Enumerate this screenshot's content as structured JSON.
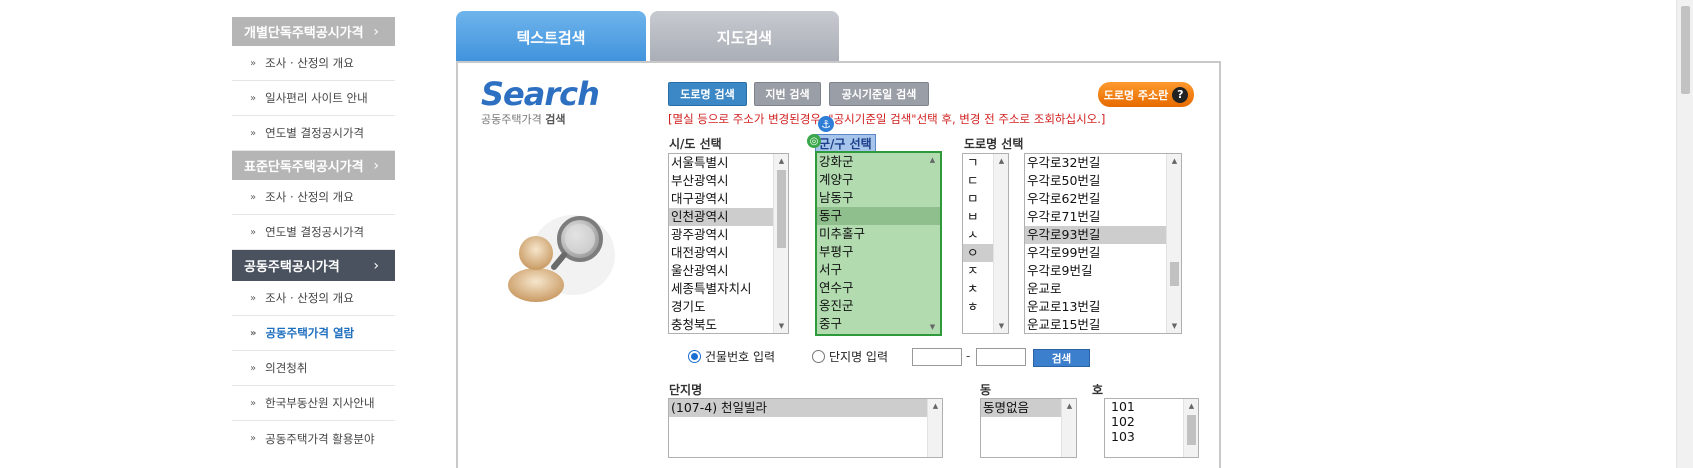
{
  "sidebar": {
    "sections": [
      {
        "title": "개별단독주택공시가격",
        "items": [
          "조사 · 산정의 개요",
          "일사편리 사이트 안내",
          "연도별 결정공시가격"
        ]
      },
      {
        "title": "표준단독주택공시가격",
        "items": [
          "조사 · 산정의 개요",
          "연도별 결정공시가격"
        ]
      },
      {
        "title": "공동주택공시가격",
        "items": [
          "조사 · 산정의 개요",
          "공동주택가격 열람",
          "의견청취",
          "한국부동산원 지사안내",
          "공동주택가격 활용분야"
        ]
      }
    ],
    "chevron": "›",
    "bullet": "»"
  },
  "tabs": {
    "text_search": "텍스트검색",
    "map_search": "지도검색"
  },
  "brand": {
    "title": "Search",
    "sub_prefix": "공동주택가격",
    "sub_bold": "검색"
  },
  "buttons": {
    "road_search": "도로명 검색",
    "jibun_search": "지번 검색",
    "date_search": "공시기준일 검색",
    "road_addr": "도로명 주소란",
    "road_addr_help": "?"
  },
  "notice": "[멸실 등으로 주소가 변경된경우, \"공시기준일 검색\"선택 후, 변경 전 주소로 조회하십시오.]",
  "labels": {
    "sido": "시/도 선택",
    "gungu": "군/구 선택",
    "road": "도로명 선택"
  },
  "lists": {
    "sido": [
      "서울특별시",
      "부산광역시",
      "대구광역시",
      "인천광역시",
      "광주광역시",
      "대전광역시",
      "울산광역시",
      "세종특별자치시",
      "경기도",
      "충청북도"
    ],
    "sido_selected": "인천광역시",
    "gungu": [
      "강화군",
      "계양구",
      "남동구",
      "동구",
      "미추홀구",
      "부평구",
      "서구",
      "연수구",
      "옹진군",
      "중구"
    ],
    "gungu_selected": "동구",
    "consonants": [
      "ㄱ",
      "ㄷ",
      "ㅁ",
      "ㅂ",
      "ㅅ",
      "ㅇ",
      "ㅈ",
      "ㅊ",
      "ㅎ"
    ],
    "consonant_selected": "ㅇ",
    "roads": [
      "우각로32번길",
      "우각로50번길",
      "우각로62번길",
      "우각로71번길",
      "우각로93번길",
      "우각로99번길",
      "우각로9번길",
      "운교로",
      "운교로13번길",
      "운교로15번길"
    ],
    "road_selected": "우각로93번길"
  },
  "search_opts": {
    "building_no": "건물번호 입력",
    "complex_name": "단지명 입력",
    "building_no_checked": true,
    "dash": "-",
    "search_btn": "검색"
  },
  "results": {
    "danji_label": "단지명",
    "dong_label": "동",
    "ho_label": "호",
    "danji": [
      "(107-4) 천일빌라"
    ],
    "dong": [
      "동명없음"
    ],
    "ho": [
      "101",
      "102",
      "103"
    ]
  },
  "icons": {
    "anchor": "anchor-icon",
    "target": "target-icon",
    "avatar": "user-search-icon"
  },
  "colors": {
    "tab_active": "#3f92dc",
    "notice": "#d12020",
    "selected_list_bg": "#b2dcb0",
    "orange_button": "#e66a00"
  }
}
